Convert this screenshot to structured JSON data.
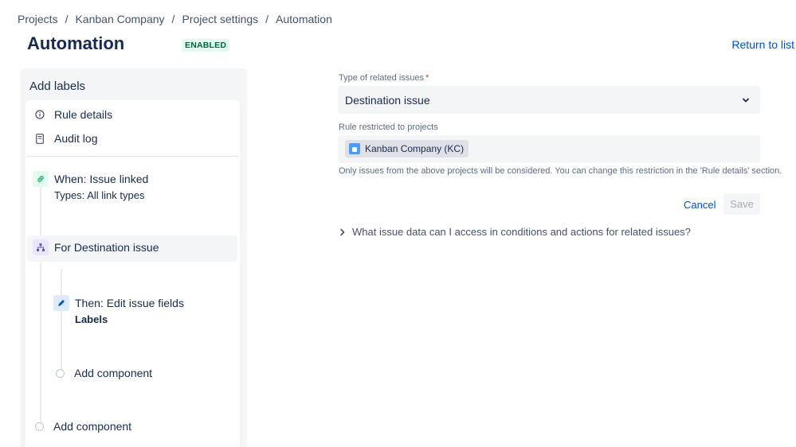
{
  "breadcrumb": {
    "items": [
      "Projects",
      "Kanban Company",
      "Project settings",
      "Automation"
    ],
    "separator": "/"
  },
  "header": {
    "title": "Automation",
    "status": "ENABLED",
    "return_link": "Return to list"
  },
  "rule": {
    "name": "Add labels",
    "links": {
      "details": "Rule details",
      "audit": "Audit log"
    },
    "trigger": {
      "label": "When: Issue linked",
      "sub": "Types: All link types",
      "icon": "link-icon",
      "color": "#36b37e"
    },
    "branch": {
      "label": "For Destination issue",
      "icon": "branch-icon",
      "color": "#6554c0"
    },
    "action": {
      "label": "Then: Edit issue fields",
      "sub": "Labels",
      "icon": "pencil-icon",
      "color": "#0052cc"
    },
    "add_component_inner": "Add component",
    "add_component_outer": "Add component"
  },
  "form": {
    "related_label": "Type of related issues",
    "required_marker": "*",
    "related_value": "Destination issue",
    "projects_label": "Rule restricted to projects",
    "project_tag": "Kanban Company (KC)",
    "helper": "Only issues from the above projects will be considered. You can change this restriction in the 'Rule details' section.",
    "cancel": "Cancel",
    "save": "Save",
    "faq": "What issue data can I access in conditions and actions for related issues?"
  },
  "colors": {
    "accent": "#0052cc",
    "enabled_bg": "#e3fcef",
    "enabled_text": "#006644"
  }
}
